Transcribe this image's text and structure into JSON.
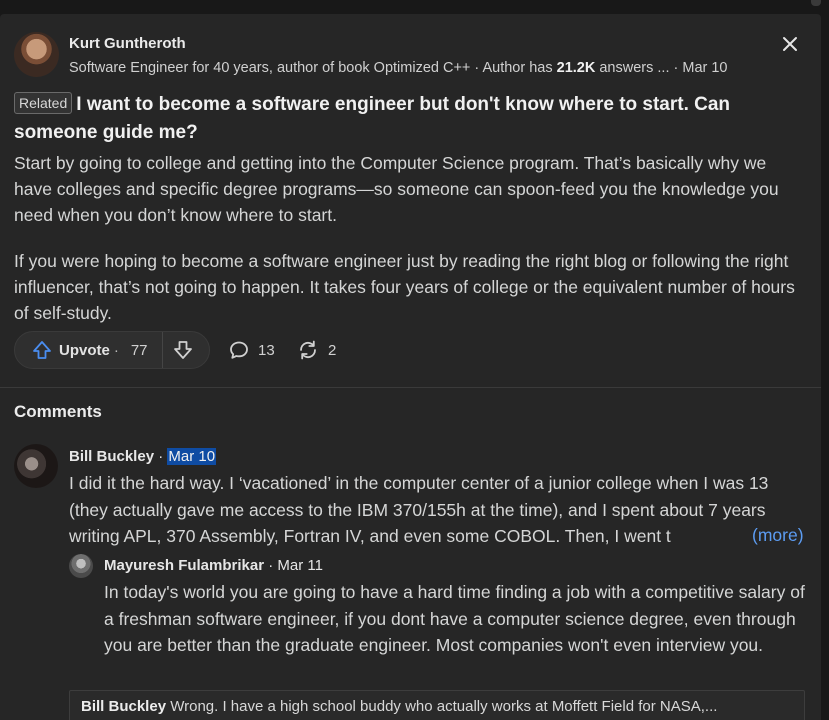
{
  "answer": {
    "author_name": "Kurt Guntheroth",
    "credential_prefix": "Software Engineer for 40 years, author of book Optimized C++ · Author has ",
    "credential_count": "21.2K",
    "credential_suffix": " answers ...",
    "date": " · Mar 10",
    "related_tag": "Related",
    "question": "I want to become a software engineer but don't know where to start. Can someone guide me?",
    "paragraph1": "Start by going to college and getting into the Computer Science program. That’s basically why we have colleges and specific degree programs—so someone can spoon-feed you the knowledge you need when you don’t know where to start.",
    "paragraph2": "If you were hoping to become a software engineer just by reading the right blog or following the right influencer, that’s not going to happen. It takes four years of college or the equivalent number of hours of self-study."
  },
  "actions": {
    "upvote_label": "Upvote",
    "upvote_sep": "·",
    "upvote_count": "77",
    "comment_count": "13",
    "share_count": "2"
  },
  "comments": {
    "title": "Comments",
    "items": [
      {
        "author": "Bill Buckley",
        "sep": " · ",
        "date": "Mar 10",
        "body": "I did it the hard way. I ‘vacationed’ in the computer center of a junior college when I was 13 (they actually gave me access to the IBM 370/155h at the time), and I spent about 7 years writing APL, 370 Assembly, Fortran IV, and even some COBOL. Then, I went t",
        "more": "(more)"
      },
      {
        "author": "Mayuresh Fulambrikar",
        "sep": " · ",
        "date": "Mar 11",
        "body": "In today's world you are going to have a hard time finding a job with a competitive salary of a freshman software engineer, if you dont have a computer science degree, even through you are better than the graduate engineer. Most companies won't even interview you."
      }
    ],
    "collapsed_reply": {
      "author": "Bill Buckley",
      "text": " Wrong. I have a high school buddy who actually works at Moffett Field for NASA,..."
    }
  },
  "colors": {
    "background": "#262626",
    "link": "#5c9cf2",
    "upvote_icon": "#4a8df0",
    "highlight": "#0f4ca3"
  },
  "icons": [
    "close-icon",
    "upvote-arrow-icon",
    "downvote-arrow-icon",
    "comment-bubble-icon",
    "share-reload-icon"
  ]
}
